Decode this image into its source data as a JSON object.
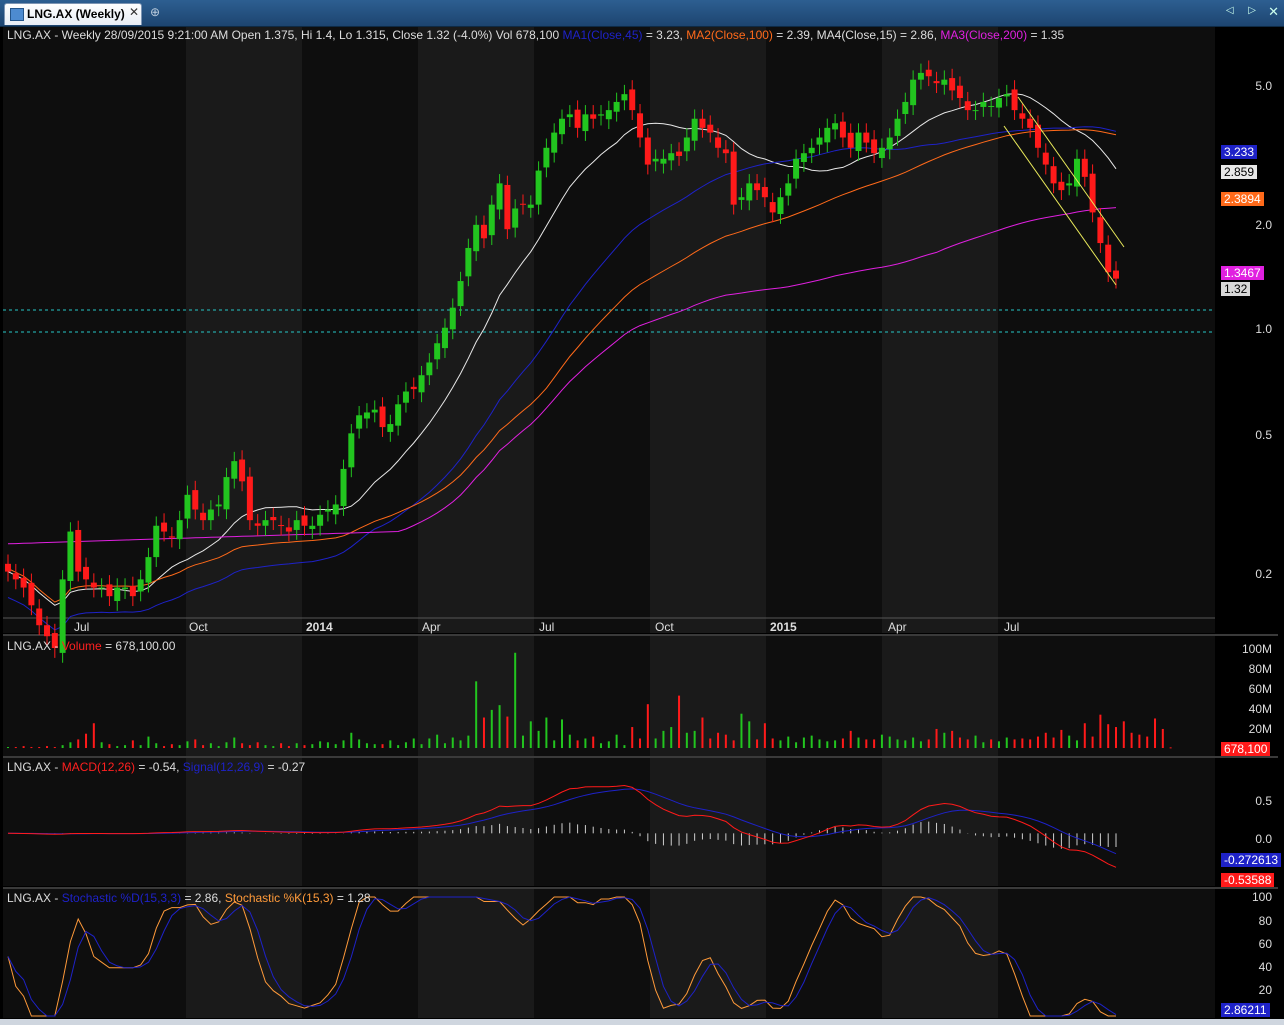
{
  "tab": {
    "label": "LNG.AX (Weekly)",
    "close": "✕",
    "new_icon": "⊕"
  },
  "nav": {
    "arrows": "◁ ▷",
    "close": "✕"
  },
  "price_header": {
    "symbol": "LNG.AX - Weekly 28/09/2015 9:21:00 AM Open 1.375, Hi 1.4, Lo 1.315, Close 1.32 (-4.0%) Vol 678,100",
    "ma1": "MA1(Close,45)",
    "ma1_val": "= 3.23,",
    "ma2": "MA2(Close,100)",
    "ma2_val": "= 2.39,",
    "ma4": "MA4(Close,15)",
    "ma4_val": "= 2.86,",
    "ma3": "MA3(Close,200)",
    "ma3_val": "= 1.35"
  },
  "volume_header": {
    "symbol": "LNG.AX -",
    "name": "Volume",
    "val": "= 678,100.00"
  },
  "macd_header": {
    "symbol": "LNG.AX -",
    "name": "MACD(12,26)",
    "val": "= -0.54,",
    "signal": "Signal(12,26,9)",
    "signal_val": "= -0.27"
  },
  "stoch_header": {
    "symbol": "LNG.AX -",
    "name": "Stochastic %D(15,3,3)",
    "val": "= 2.86,",
    "k": "Stochastic %K(15,3)",
    "k_val": "= 1.28"
  },
  "colors": {
    "up": "#22c51f",
    "down": "#ff1a1a",
    "ma1": "#1e22c8",
    "ma2": "#ff6a1a",
    "ma3": "#e020e0",
    "ma4": "#e8e8e8",
    "trend": "#e8e85a",
    "level": "#26c6c6"
  },
  "tags": {
    "price": {
      "ma1": "3.233",
      "ma4": "2.859",
      "ma2": "2.3894",
      "ma3": "1.3467",
      "close": "1.32"
    },
    "volume": "678,100",
    "macd": {
      "signal": "-0.272613",
      "macd": "-0.53588"
    },
    "stoch": "2.86211"
  },
  "chart_data": [
    {
      "type": "candlestick",
      "title": "LNG.AX - Weekly",
      "scale": "log",
      "ylim": [
        0.155,
        5.9
      ],
      "yticks": [
        "5.0",
        "2.0",
        "1.0",
        "0.5",
        "0.2"
      ],
      "xticks": [
        "Jul",
        "Oct",
        "2014",
        "Apr",
        "Jul",
        "Oct",
        "2015",
        "Apr",
        "Jul"
      ],
      "closes": [
        0.21,
        0.2,
        0.19,
        0.17,
        0.15,
        0.14,
        0.13,
        0.2,
        0.27,
        0.21,
        0.2,
        0.19,
        0.19,
        0.18,
        0.19,
        0.19,
        0.18,
        0.2,
        0.23,
        0.28,
        0.27,
        0.26,
        0.29,
        0.34,
        0.31,
        0.29,
        0.31,
        0.32,
        0.38,
        0.42,
        0.37,
        0.29,
        0.28,
        0.29,
        0.29,
        0.28,
        0.27,
        0.29,
        0.28,
        0.28,
        0.3,
        0.31,
        0.32,
        0.4,
        0.5,
        0.56,
        0.57,
        0.58,
        0.52,
        0.53,
        0.6,
        0.65,
        0.66,
        0.72,
        0.78,
        0.88,
        0.97,
        1.1,
        1.3,
        1.6,
        1.85,
        1.7,
        2.1,
        2.4,
        1.8,
        2.05,
        2.1,
        2.1,
        2.6,
        3.0,
        3.3,
        3.6,
        3.7,
        3.4,
        3.7,
        3.6,
        3.7,
        3.8,
        4.0,
        4.2,
        3.8,
        3.2,
        2.7,
        2.8,
        2.8,
        2.9,
        2.85,
        3.2,
        3.6,
        3.4,
        3.3,
        3.0,
        2.9,
        2.1,
        2.2,
        2.4,
        2.3,
        2.2,
        2.0,
        2.2,
        2.4,
        2.8,
        2.9,
        3.0,
        3.2,
        3.4,
        3.5,
        3.2,
        3.0,
        3.3,
        3.1,
        2.9,
        3.0,
        3.2,
        3.6,
        4.0,
        4.6,
        4.8,
        4.7,
        4.5,
        4.6,
        4.3,
        4.1,
        3.8,
        3.8,
        4.0,
        3.9,
        4.1,
        4.2,
        3.8,
        3.6,
        3.4,
        3.0,
        2.7,
        2.4,
        2.3,
        2.4,
        2.8,
        2.5,
        2.0,
        1.65,
        1.375,
        1.32
      ],
      "ma1": {
        "name": "MA1(Close,45)",
        "last": 3.23
      },
      "ma2": {
        "name": "MA2(Close,100)",
        "last": 2.39
      },
      "ma3": {
        "name": "MA3(Close,200)",
        "last": 1.35
      },
      "ma4": {
        "name": "MA4(Close,15)",
        "last": 2.86
      }
    },
    {
      "type": "bar",
      "title": "Volume",
      "yticks": [
        "100M",
        "80M",
        "60M",
        "40M",
        "20M"
      ],
      "ylim": [
        0,
        105
      ],
      "values": [
        1,
        1,
        2,
        1,
        1,
        2,
        1,
        3,
        6,
        9,
        15,
        26,
        6,
        4,
        2,
        3,
        8,
        3,
        12,
        5,
        2,
        4,
        3,
        7,
        9,
        3,
        5,
        2,
        6,
        11,
        5,
        3,
        6,
        3,
        2,
        5,
        2,
        5,
        3,
        4,
        7,
        6,
        4,
        8,
        16,
        9,
        5,
        4,
        4,
        8,
        3,
        6,
        10,
        4,
        10,
        14,
        5,
        11,
        8,
        13,
        70,
        32,
        40,
        45,
        33,
        100,
        13,
        28,
        18,
        32,
        8,
        30,
        14,
        8,
        10,
        12,
        5,
        7,
        14,
        3,
        22,
        10,
        46,
        10,
        18,
        22,
        55,
        16,
        18,
        32,
        10,
        16,
        14,
        8,
        36,
        28,
        9,
        26,
        10,
        8,
        12,
        6,
        11,
        13,
        9,
        7,
        8,
        10,
        18,
        11,
        9,
        9,
        14,
        12,
        9,
        8,
        11,
        7,
        9,
        20,
        16,
        18,
        11,
        9,
        13,
        6,
        9,
        7,
        11,
        9,
        10,
        9,
        12,
        16,
        11,
        19,
        13,
        8,
        26,
        12,
        35,
        25,
        22,
        28,
        16,
        14,
        12,
        31,
        20,
        0.678
      ]
    },
    {
      "type": "line",
      "title": "MACD(12,26)",
      "yticks": [
        "0.5",
        "0.0"
      ],
      "ylim": [
        -0.8,
        1.0
      ],
      "macd_last": -0.54,
      "signal_last": -0.27
    },
    {
      "type": "line",
      "title": "Stochastic",
      "yticks": [
        "100",
        "80",
        "60",
        "40",
        "20"
      ],
      "ylim": [
        0,
        100
      ],
      "d_last": 2.86,
      "k_last": 1.28
    }
  ]
}
